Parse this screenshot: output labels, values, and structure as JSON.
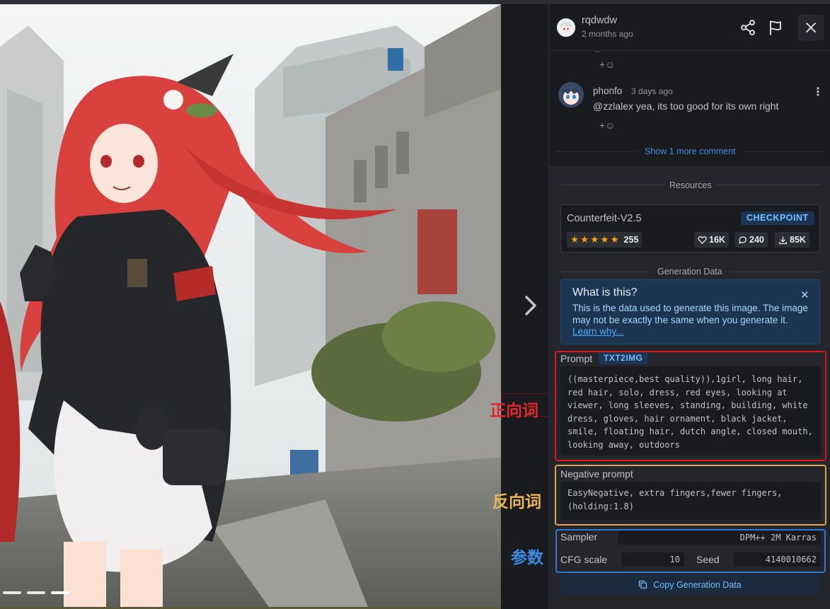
{
  "annotations": {
    "positive": "正向词",
    "negative": "反向词",
    "params": "参数"
  },
  "header": {
    "username": "rqdwdw",
    "time_ago": "2 months ago",
    "icons": [
      "share-icon",
      "flag-icon",
      "close-icon"
    ]
  },
  "comments": {
    "reply_icon": "+☺",
    "items": [
      {
        "author": "phonfo",
        "time": "3 days ago",
        "text": "@zzlalex yea, its too good for its own right",
        "menu": "⋮"
      }
    ],
    "show_more": "Show 1 more comment"
  },
  "resources": {
    "label": "Resources",
    "items": [
      {
        "name": "Counterfeit-V2.5",
        "badge": "CHECKPOINT",
        "rating_stars": 5,
        "rating_count": "255",
        "likes": "16K",
        "comments": "240",
        "downloads": "85K"
      }
    ]
  },
  "generation": {
    "label": "Generation Data",
    "info": {
      "title": "What is this?",
      "text": "This is the data used to generate this image. The image may not be exactly the same when you generate it.",
      "link": "Learn why..."
    },
    "prompt": {
      "label": "Prompt",
      "badge": "TXT2IMG",
      "text": "((masterpiece,best quality)),1girl, long hair, red hair, solo, dress, red eyes, looking at viewer, long sleeves, standing, building, white dress, gloves, hair ornament, black jacket, smile, floating hair, dutch angle, closed mouth, looking away, outdoors"
    },
    "negative": {
      "label": "Negative prompt",
      "text": "EasyNegative, extra fingers,fewer fingers, (holding:1.8)"
    },
    "params": {
      "sampler_label": "Sampler",
      "sampler": "DPM++ 2M Karras",
      "cfg_label": "CFG scale",
      "cfg": "10",
      "seed_label": "Seed",
      "seed": "4140010662"
    },
    "copy_button": "Copy Generation Data"
  },
  "colors": {
    "accent": "#3c8de6",
    "prompt_frame": "#e0141e",
    "negative_frame": "#e0a64b",
    "params_frame": "#2b7bd3",
    "star": "#f59f00"
  }
}
